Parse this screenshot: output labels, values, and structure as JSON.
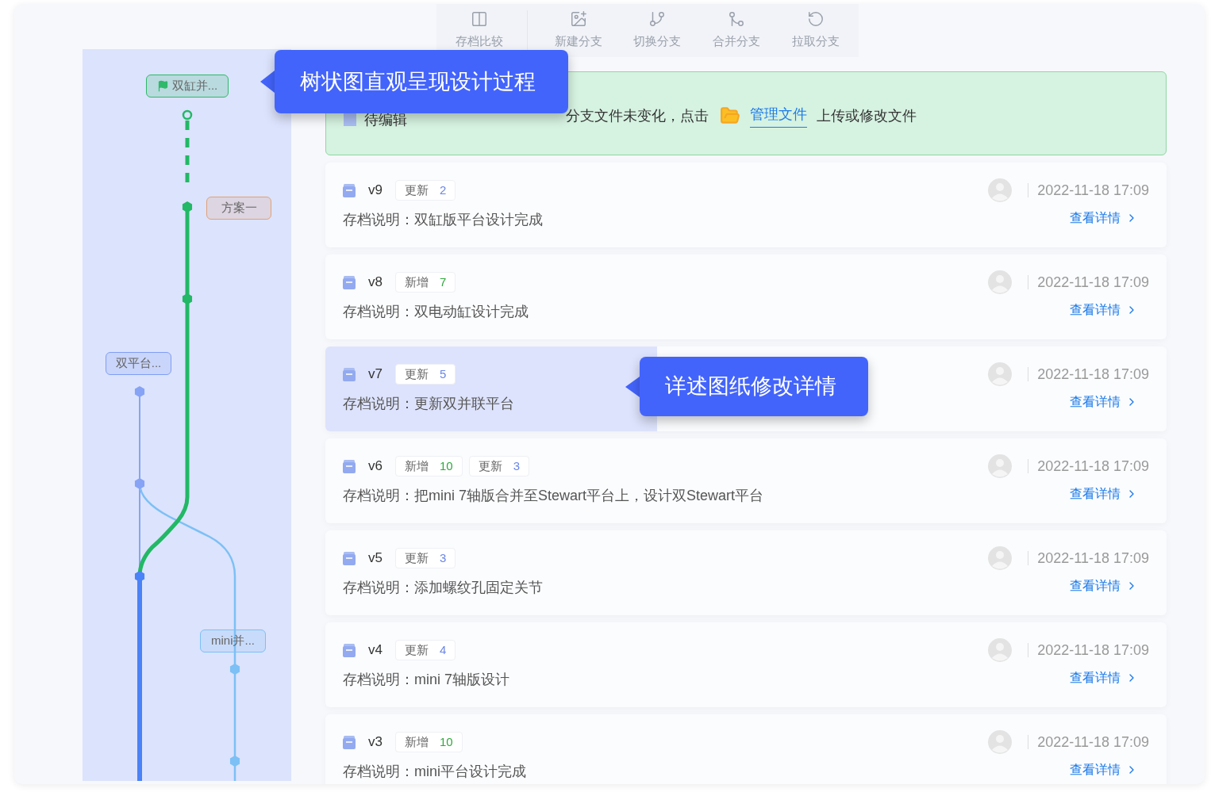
{
  "toolbar": [
    {
      "label": "存档比较",
      "kind": "compare"
    },
    {
      "label": "新建分支",
      "kind": "new"
    },
    {
      "label": "切换分支",
      "kind": "switch"
    },
    {
      "label": "合并分支",
      "kind": "merge"
    },
    {
      "label": "拉取分支",
      "kind": "pull"
    }
  ],
  "tree": {
    "labels": [
      {
        "text": "双缸并...",
        "kind": "flag",
        "color": "#2fb96a"
      },
      {
        "text": "方案一",
        "kind": "plain",
        "color": "#e0a27a"
      },
      {
        "text": "双平台...",
        "kind": "plain",
        "color": "#7f9ef5"
      },
      {
        "text": "mini并...",
        "kind": "plain",
        "color": "#7cc0f5"
      }
    ]
  },
  "banner": {
    "status": "待编辑",
    "message": "分支文件未变化，点击",
    "link": "管理文件",
    "after": "上传或修改文件"
  },
  "versions": [
    {
      "version": "v9",
      "tags": [
        {
          "label": "更新",
          "count": "2",
          "kind": "update"
        }
      ],
      "description": "存档说明：双缸版平台设计完成",
      "selected": false,
      "date": "2022-11-18 17:09",
      "link": "查看详情"
    },
    {
      "version": "v8",
      "tags": [
        {
          "label": "新增",
          "count": "7",
          "kind": "add"
        }
      ],
      "description": "存档说明：双电动缸设计完成",
      "selected": false,
      "date": "2022-11-18 17:09",
      "link": "查看详情"
    },
    {
      "version": "v7",
      "tags": [
        {
          "label": "更新",
          "count": "5",
          "kind": "update"
        }
      ],
      "description": "存档说明：更新双并联平台",
      "selected": true,
      "date": "2022-11-18 17:09",
      "link": "查看详情"
    },
    {
      "version": "v6",
      "tags": [
        {
          "label": "新增",
          "count": "10",
          "kind": "add"
        },
        {
          "label": "更新",
          "count": "3",
          "kind": "update"
        }
      ],
      "description": "存档说明：把mini 7轴版合并至Stewart平台上，设计双Stewart平台",
      "selected": false,
      "date": "2022-11-18 17:09",
      "link": "查看详情"
    },
    {
      "version": "v5",
      "tags": [
        {
          "label": "更新",
          "count": "3",
          "kind": "update"
        }
      ],
      "description": "存档说明：添加螺纹孔固定关节",
      "selected": false,
      "date": "2022-11-18 17:09",
      "link": "查看详情"
    },
    {
      "version": "v4",
      "tags": [
        {
          "label": "更新",
          "count": "4",
          "kind": "update"
        }
      ],
      "description": "存档说明：mini 7轴版设计",
      "selected": false,
      "date": "2022-11-18 17:09",
      "link": "查看详情"
    },
    {
      "version": "v3",
      "tags": [
        {
          "label": "新增",
          "count": "10",
          "kind": "add"
        }
      ],
      "description": "存档说明：mini平台设计完成",
      "selected": false,
      "date": "2022-11-18 17:09",
      "link": "查看详情"
    }
  ],
  "callouts": [
    "树状图直观呈现设计过程",
    "详述图纸修改详情"
  ]
}
